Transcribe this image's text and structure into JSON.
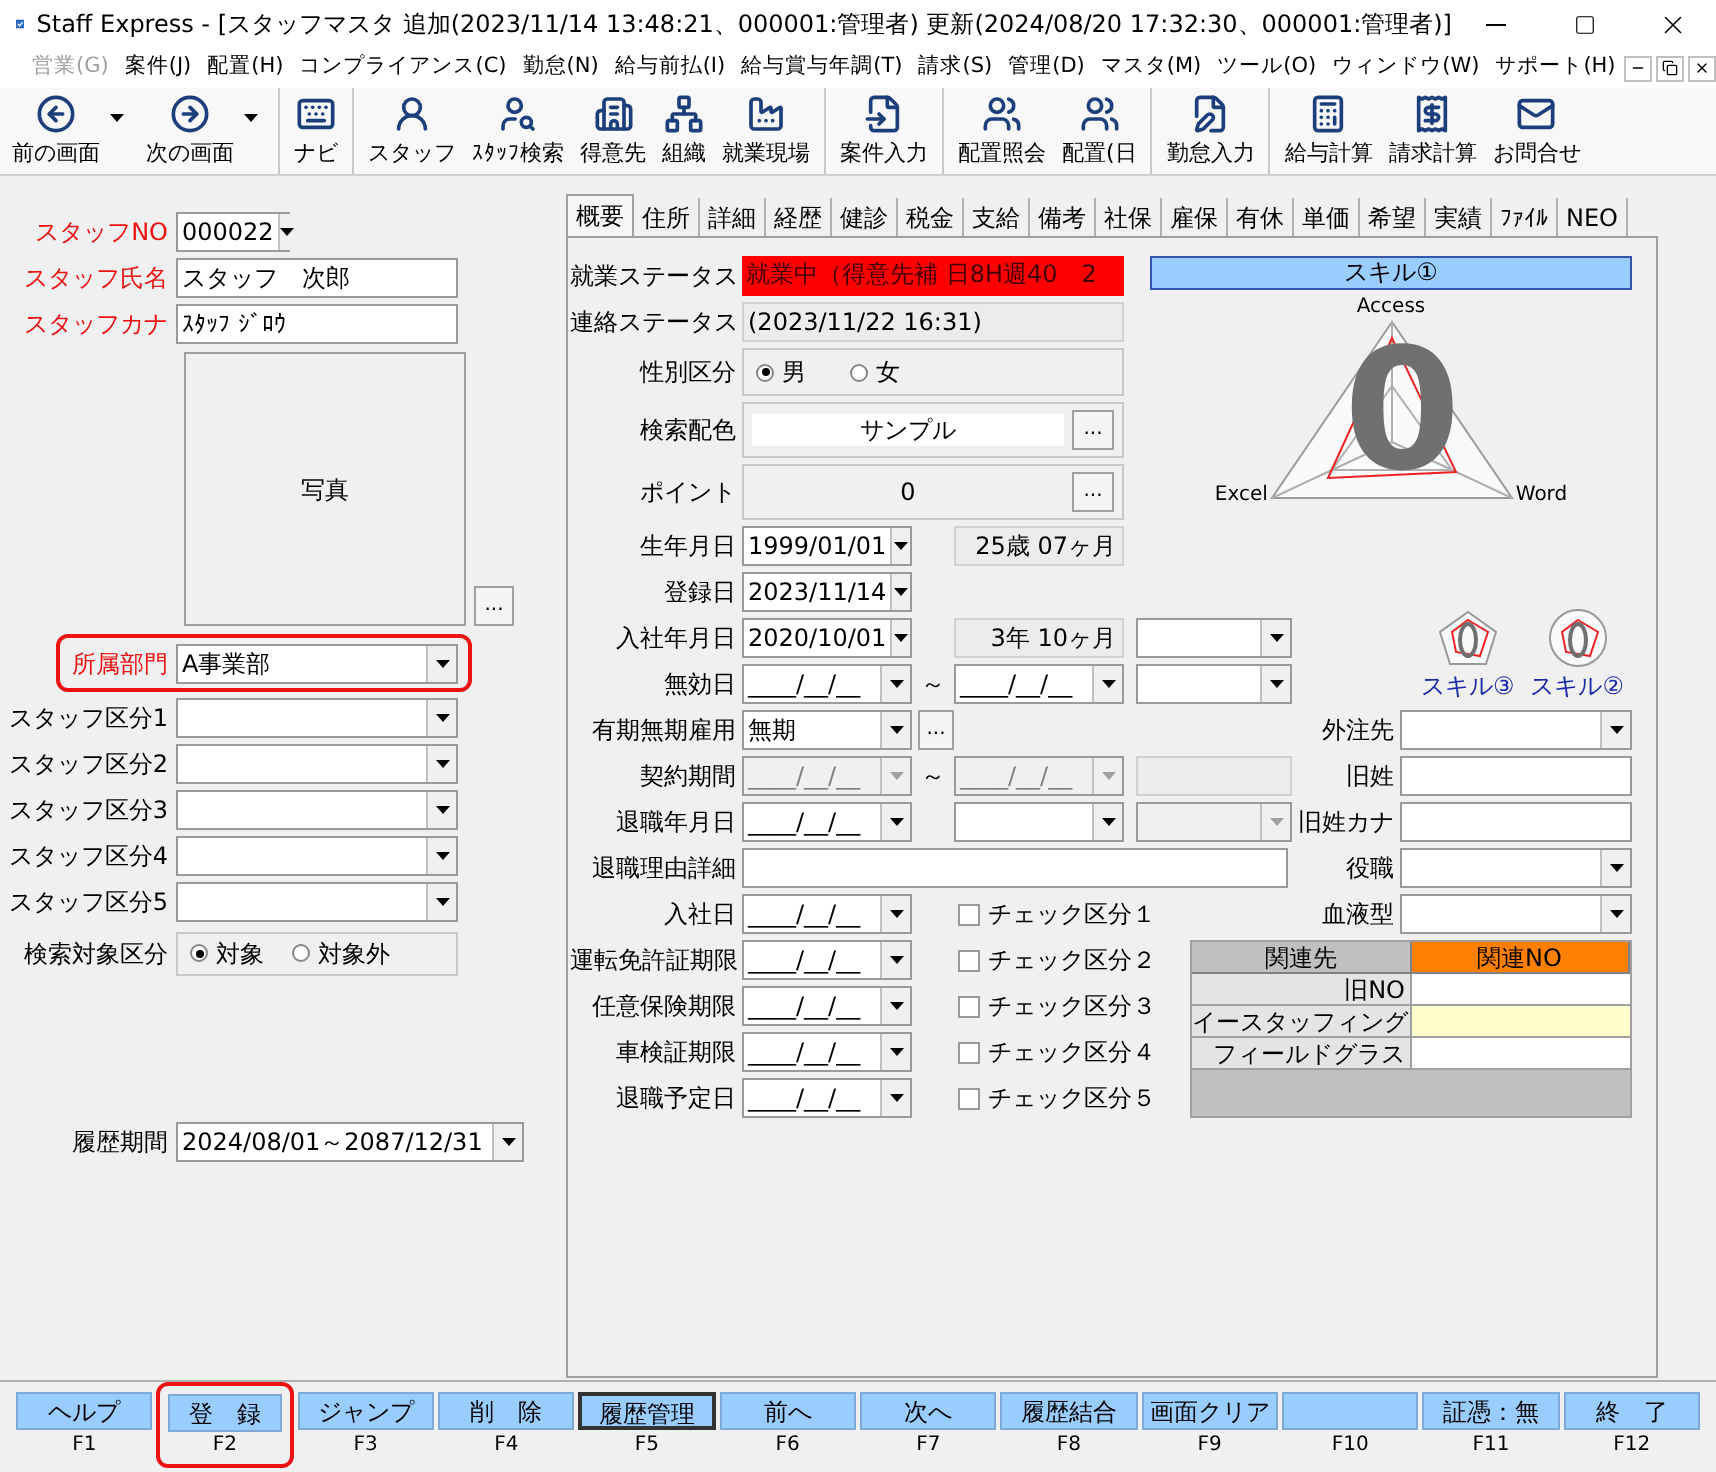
{
  "window": {
    "title": "Staff Express - [スタッフマスタ 追加(2023/11/14 13:48:21、000001:管理者) 更新(2024/08/20 17:32:30、000001:管理者)]"
  },
  "menu": [
    {
      "label": "営業(G)",
      "disabled": true
    },
    {
      "label": "案件(J)",
      "disabled": false
    },
    {
      "label": "配置(H)",
      "disabled": false
    },
    {
      "label": "コンプライアンス(C)",
      "disabled": false
    },
    {
      "label": "勤怠(N)",
      "disabled": false
    },
    {
      "label": "給与前払(I)",
      "disabled": false
    },
    {
      "label": "給与賞与年調(T)",
      "disabled": false
    },
    {
      "label": "請求(S)",
      "disabled": false
    },
    {
      "label": "管理(D)",
      "disabled": false
    },
    {
      "label": "マスタ(M)",
      "disabled": false
    },
    {
      "label": "ツール(O)",
      "disabled": false
    },
    {
      "label": "ウィンドウ(W)",
      "disabled": false
    },
    {
      "label": "サポート(H)",
      "disabled": false
    }
  ],
  "toolbar": [
    [
      {
        "label": "前の画面",
        "dropdown": true
      },
      {
        "label": "次の画面",
        "dropdown": true
      }
    ],
    [
      {
        "label": "ナビ",
        "dropdown": false
      }
    ],
    [
      {
        "label": "スタッフ",
        "dropdown": false
      },
      {
        "label": "ｽﾀｯﾌ検索",
        "dropdown": false
      },
      {
        "label": "得意先",
        "dropdown": false
      },
      {
        "label": "組織",
        "dropdown": false
      },
      {
        "label": "就業現場",
        "dropdown": false
      }
    ],
    [
      {
        "label": "案件入力",
        "dropdown": false
      }
    ],
    [
      {
        "label": "配置照会",
        "dropdown": false
      },
      {
        "label": "配置(日",
        "dropdown": false
      }
    ],
    [
      {
        "label": "勤怠入力",
        "dropdown": false
      }
    ],
    [
      {
        "label": "給与計算",
        "dropdown": false
      },
      {
        "label": "請求計算",
        "dropdown": false
      },
      {
        "label": "お問合せ",
        "dropdown": false
      }
    ]
  ],
  "staff_panel": {
    "fields": [
      {
        "kind": "number_combo",
        "label": "スタッフNO",
        "value": "000022",
        "required": true,
        "highlighted": false
      },
      {
        "kind": "text",
        "label": "スタッフ氏名",
        "value": "スタッフ　次郎",
        "required": true,
        "highlighted": false
      },
      {
        "kind": "text",
        "label": "スタッフカナ",
        "value": "ｽﾀｯﾌ ｼﾞﾛｳ",
        "required": true,
        "highlighted": false
      },
      {
        "kind": "photo",
        "text": "写真",
        "button": "..."
      },
      {
        "kind": "combo",
        "label": "所属部門",
        "value": "A事業部",
        "required": true,
        "highlighted": true
      },
      {
        "kind": "combo",
        "label": "スタッフ区分1",
        "required": false,
        "highlighted": false
      },
      {
        "kind": "combo",
        "label": "スタッフ区分2",
        "required": false,
        "highlighted": false
      },
      {
        "kind": "combo",
        "label": "スタッフ区分3",
        "required": false,
        "highlighted": false
      },
      {
        "kind": "combo",
        "label": "スタッフ区分4",
        "required": false,
        "highlighted": false
      },
      {
        "kind": "combo",
        "label": "スタッフ区分5",
        "required": false,
        "highlighted": false
      },
      {
        "kind": "radio",
        "label": "検索対象区分",
        "options": [
          {
            "label": "対象",
            "selected": true
          },
          {
            "label": "対象外",
            "selected": false
          }
        ]
      },
      {
        "kind": "period_combo",
        "label": "履歴期間",
        "value": "2024/08/01～2087/12/31",
        "required": false,
        "highlighted": false
      }
    ]
  },
  "tabs": [
    {
      "label": "概要",
      "selected": true
    },
    {
      "label": "住所",
      "selected": false
    },
    {
      "label": "詳細",
      "selected": false
    },
    {
      "label": "経歴",
      "selected": false
    },
    {
      "label": "健診",
      "selected": false
    },
    {
      "label": "税金",
      "selected": false
    },
    {
      "label": "支給",
      "selected": false
    },
    {
      "label": "備考",
      "selected": false
    },
    {
      "label": "社保",
      "selected": false
    },
    {
      "label": "雇保",
      "selected": false
    },
    {
      "label": "有休",
      "selected": false
    },
    {
      "label": "単価",
      "selected": false
    },
    {
      "label": "希望",
      "selected": false
    },
    {
      "label": "実績",
      "selected": false
    },
    {
      "label": "ﾌｧｲﾙ",
      "selected": false
    },
    {
      "label": "NEO",
      "selected": false
    }
  ],
  "overview": {
    "rows": [
      {
        "label": "就業ステータス",
        "controls": [
          {
            "kind": "status",
            "value": "就業中（得意先補 日8H週40　2",
            "color": "#ff0000"
          }
        ]
      },
      {
        "label": "連絡ステータス",
        "controls": [
          {
            "kind": "readonly",
            "value": "(2023/11/22 16:31)"
          }
        ]
      },
      {
        "label": "性別区分",
        "controls": [
          {
            "kind": "radio",
            "options": [
              {
                "label": "男",
                "selected": true
              },
              {
                "label": "女",
                "selected": false
              }
            ]
          }
        ]
      },
      {
        "label": "検索配色",
        "controls": [
          {
            "kind": "swatch",
            "value": "サンプル",
            "button": "..."
          }
        ]
      },
      {
        "label": "ポイント",
        "controls": [
          {
            "kind": "point",
            "value": "0",
            "button": "..."
          }
        ]
      },
      {
        "label": "生年月日",
        "controls": [
          {
            "kind": "date",
            "value": "1999/01/01",
            "disabled": false
          },
          {
            "kind": "age",
            "value": "25歳 07ヶ月"
          }
        ]
      },
      {
        "label": "登録日",
        "controls": [
          {
            "kind": "date",
            "value": "2023/11/14",
            "disabled": false
          }
        ]
      },
      {
        "label": "入社年月日",
        "controls": [
          {
            "kind": "date",
            "value": "2020/10/01",
            "disabled": false
          },
          {
            "kind": "age",
            "value": "3年 10ヶ月"
          },
          {
            "kind": "combo",
            "disabled": false
          }
        ]
      },
      {
        "label": "無効日",
        "controls": [
          {
            "kind": "date",
            "value": "____/__/__",
            "disabled": false
          },
          {
            "kind": "tilde",
            "text": "～"
          },
          {
            "kind": "date",
            "value": "____/__/__",
            "disabled": false
          },
          {
            "kind": "combo",
            "disabled": false
          }
        ]
      },
      {
        "label": "有期無期雇用",
        "controls": [
          {
            "kind": "combo",
            "value": "無期",
            "disabled": false
          },
          {
            "kind": "ellipsis",
            "text": "..."
          }
        ],
        "right": {
          "label": "外注先",
          "kind": "combo"
        }
      },
      {
        "label": "契約期間",
        "controls": [
          {
            "kind": "date",
            "value": "____/__/__",
            "disabled": true
          },
          {
            "kind": "tilde",
            "text": "～"
          },
          {
            "kind": "date",
            "value": "____/__/__",
            "disabled": true
          },
          {
            "kind": "field",
            "disabled": true
          }
        ],
        "right": {
          "label": "旧姓",
          "kind": "field"
        }
      },
      {
        "label": "退職年月日",
        "controls": [
          {
            "kind": "date",
            "value": "____/__/__",
            "disabled": false
          },
          {
            "kind": "combo",
            "disabled": false
          },
          {
            "kind": "combo",
            "disabled": true
          }
        ],
        "right": {
          "label": "旧姓カナ",
          "kind": "field"
        }
      },
      {
        "label": "退職理由詳細",
        "controls": [
          {
            "kind": "memo"
          }
        ],
        "right": {
          "label": "役職",
          "kind": "combo"
        }
      },
      {
        "label": "入社日",
        "controls": [
          {
            "kind": "date",
            "value": "____/__/__",
            "disabled": false
          },
          {
            "kind": "check",
            "label": "チェック区分１",
            "checked": false
          }
        ],
        "right": {
          "label": "血液型",
          "kind": "combo"
        }
      },
      {
        "label": "運転免許証期限",
        "controls": [
          {
            "kind": "date",
            "value": "____/__/__",
            "disabled": false
          },
          {
            "kind": "check",
            "label": "チェック区分２",
            "checked": false
          }
        ]
      },
      {
        "label": "任意保険期限",
        "controls": [
          {
            "kind": "date",
            "value": "____/__/__",
            "disabled": false
          },
          {
            "kind": "check",
            "label": "チェック区分３",
            "checked": false
          }
        ]
      },
      {
        "label": "車検証期限",
        "controls": [
          {
            "kind": "date",
            "value": "____/__/__",
            "disabled": false
          },
          {
            "kind": "check",
            "label": "チェック区分４",
            "checked": false
          }
        ]
      },
      {
        "label": "退職予定日",
        "controls": [
          {
            "kind": "date",
            "value": "____/__/__",
            "disabled": false
          },
          {
            "kind": "check",
            "label": "チェック区分５",
            "checked": false
          }
        ]
      }
    ]
  },
  "skills": {
    "title": "スキル①",
    "axes": [
      "Access",
      "Excel",
      "Word"
    ],
    "score": "0",
    "links": [
      {
        "label": "スキル③"
      },
      {
        "label": "スキル②"
      }
    ]
  },
  "related": {
    "columns": [
      {
        "label": "関連先",
        "selected": false
      },
      {
        "label": "関連NO",
        "selected": true
      }
    ],
    "rows": [
      {
        "name": "旧NO",
        "selected": false
      },
      {
        "name": "イースタッフィング",
        "selected": true
      },
      {
        "name": "フィールドグラス",
        "selected": false
      }
    ]
  },
  "function_keys": [
    {
      "key": "F1",
      "label": "ヘルプ",
      "selected": false,
      "highlighted": false
    },
    {
      "key": "F2",
      "label": "登　録",
      "selected": false,
      "highlighted": true
    },
    {
      "key": "F3",
      "label": "ジャンプ",
      "selected": false,
      "highlighted": false
    },
    {
      "key": "F4",
      "label": "削　除",
      "selected": false,
      "highlighted": false
    },
    {
      "key": "F5",
      "label": "履歴管理",
      "selected": true,
      "highlighted": false
    },
    {
      "key": "F6",
      "label": "前へ",
      "selected": false,
      "highlighted": false
    },
    {
      "key": "F7",
      "label": "次へ",
      "selected": false,
      "highlighted": false
    },
    {
      "key": "F8",
      "label": "履歴結合",
      "selected": false,
      "highlighted": false
    },
    {
      "key": "F9",
      "label": "画面クリア",
      "selected": false,
      "highlighted": false
    },
    {
      "key": "F10",
      "selected": false,
      "highlighted": false
    },
    {
      "key": "F11",
      "label": "証憑：無",
      "selected": false,
      "highlighted": false
    },
    {
      "key": "F12",
      "label": "終　了",
      "selected": false,
      "highlighted": false
    }
  ]
}
